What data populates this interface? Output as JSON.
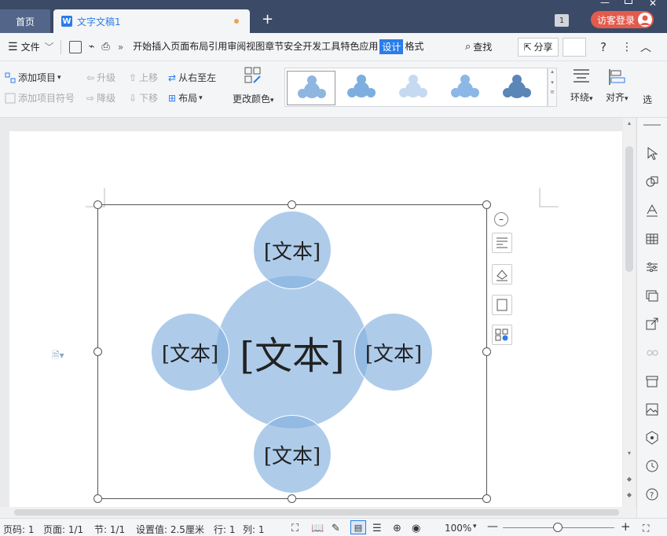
{
  "tabs": {
    "home": "首页",
    "doc": "文字文稿1",
    "new": "+"
  },
  "title_badge": "1",
  "login": "访客登录",
  "menu": {
    "file": "文件",
    "items": [
      "开始",
      "插入",
      "页面布局",
      "引用",
      "审阅",
      "视图",
      "章节",
      "安全",
      "开发工具",
      "特色应用",
      "设计",
      "格式"
    ],
    "active": "设计",
    "search": "查找",
    "share": "分享"
  },
  "ribbon": {
    "add_item": "添加项目",
    "add_bullet": "添加项目符号",
    "promote": "升级",
    "demote": "降级",
    "move_up": "上移",
    "move_down": "下移",
    "right_to_left": "从右至左",
    "layout": "布局",
    "change_color": "更改颜色",
    "wrap": "环绕",
    "align": "对齐",
    "select": "选"
  },
  "diagram": {
    "center": "[文本]",
    "top": "[文本]",
    "left": "[文本]",
    "right": "[文本]",
    "bottom": "[文本]"
  },
  "status": {
    "page_num": "页码: 1",
    "pages": "页面: 1/1",
    "section": "节: 1/1",
    "setting": "设置值: 2.5厘米",
    "row": "行: 1",
    "col": "列: 1",
    "zoom": "100%"
  },
  "colors": {
    "titlebar": "#3b4a66",
    "accent": "#2b7de9",
    "login": "#e25b4c",
    "circle": "#9fc3e8"
  }
}
